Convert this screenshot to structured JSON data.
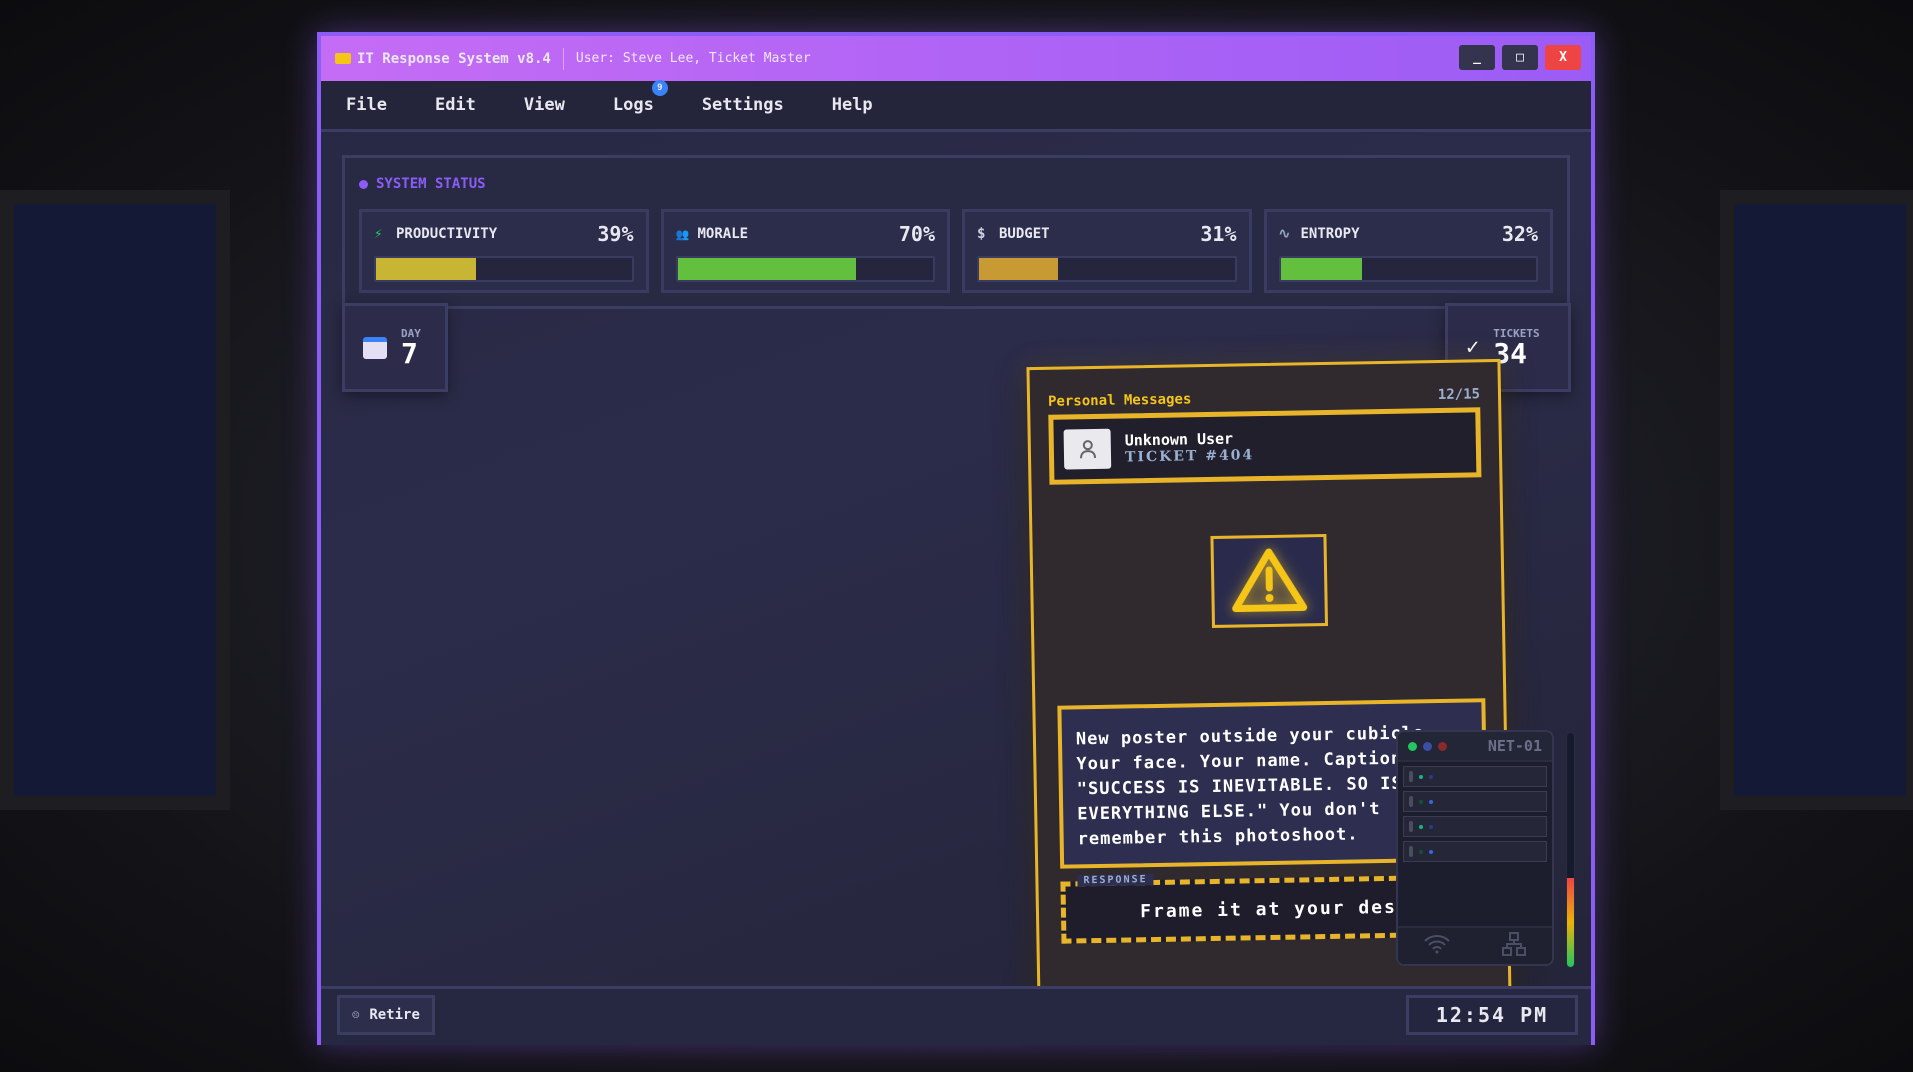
{
  "window": {
    "title": "IT Response System v8.4",
    "user": "User: Steve Lee, Ticket Master",
    "minimize": "_",
    "maximize": "□",
    "close": "X"
  },
  "menu": {
    "items": [
      "File",
      "Edit",
      "View",
      "Logs",
      "Settings",
      "Help"
    ],
    "logs_badge": "9"
  },
  "status": {
    "title": "SYSTEM STATUS",
    "stats": [
      {
        "label": "PRODUCTIVITY",
        "value": "39%",
        "fraction": 0.39,
        "color": "#c9b534",
        "icon": "⚡"
      },
      {
        "label": "MORALE",
        "value": "70%",
        "fraction": 0.7,
        "color": "#62c03e",
        "icon": "👥"
      },
      {
        "label": "BUDGET",
        "value": "31%",
        "fraction": 0.31,
        "color": "#c79a33",
        "icon": "$"
      },
      {
        "label": "ENTROPY",
        "value": "32%",
        "fraction": 0.32,
        "color": "#62c03e",
        "icon": "∿"
      }
    ]
  },
  "day": {
    "label": "DAY",
    "value": "7"
  },
  "tickets": {
    "label": "TICKETS",
    "value": "34",
    "icon": "✓"
  },
  "card": {
    "title": "Personal Messages",
    "counter": "12/15",
    "sender": "Unknown User",
    "ticket": "TICKET #404",
    "message": "New poster outside your cubicle. Your face. Your name. Caption: \"SUCCESS IS INEVITABLE. SO IS EVERYTHING ELSE.\" You don't remember this photoshoot.",
    "response_label": "RESPONSE",
    "response": "Frame it at your desk"
  },
  "net": {
    "name": "NET-01",
    "meter_level": 0.38
  },
  "footer": {
    "retire": "Retire",
    "clock": "12:54 PM"
  }
}
